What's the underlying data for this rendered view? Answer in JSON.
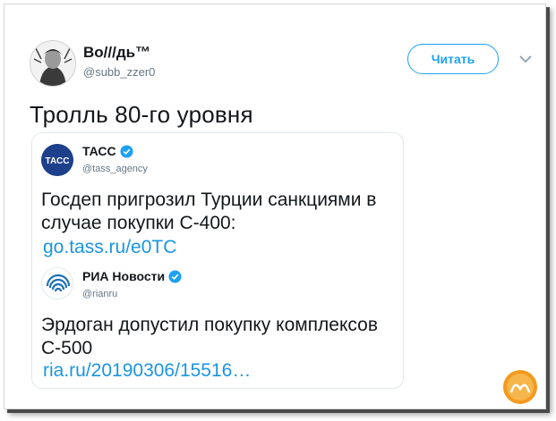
{
  "tweet": {
    "author_name": "Во///дь™",
    "author_handle": "@subb_zzer0",
    "follow_label": "Читать",
    "text": "Тролль 80-го уровня"
  },
  "quotes": [
    {
      "name": "ТАСС",
      "handle": "@tass_agency",
      "logo_text": "ТАСС",
      "text_line1": "Госдеп пригрозил Турции санкциями в",
      "text_line2": "случае покупки С-400:",
      "link": "go.tass.ru/e0TC"
    },
    {
      "name": "РИА Новости",
      "handle": "@rianru",
      "text_line1": "Эрдоган допустил покупку комплексов",
      "text_line2": "С-500",
      "link": "ria.ru/20190306/15516…"
    }
  ],
  "colors": {
    "accent": "#1da1f2",
    "link": "#1b95e0",
    "tass_blue": "#1e3f8a",
    "ria_blue": "#1d70b7",
    "watermark_orange": "#f39a1e"
  },
  "icons": {
    "caret": "chevron-down-icon",
    "verified": "verified-badge-icon",
    "watermark": "watermark-logo"
  }
}
